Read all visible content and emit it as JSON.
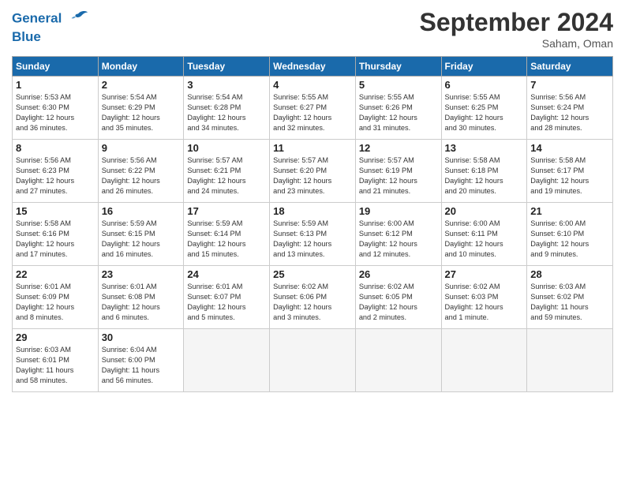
{
  "header": {
    "logo_line1": "General",
    "logo_line2": "Blue",
    "month_title": "September 2024",
    "location": "Saham, Oman"
  },
  "days_of_week": [
    "Sunday",
    "Monday",
    "Tuesday",
    "Wednesday",
    "Thursday",
    "Friday",
    "Saturday"
  ],
  "weeks": [
    [
      {
        "num": "1",
        "sunrise": "5:53 AM",
        "sunset": "6:30 PM",
        "daylight": "12 hours and 36 minutes."
      },
      {
        "num": "2",
        "sunrise": "5:54 AM",
        "sunset": "6:29 PM",
        "daylight": "12 hours and 35 minutes."
      },
      {
        "num": "3",
        "sunrise": "5:54 AM",
        "sunset": "6:28 PM",
        "daylight": "12 hours and 34 minutes."
      },
      {
        "num": "4",
        "sunrise": "5:55 AM",
        "sunset": "6:27 PM",
        "daylight": "12 hours and 32 minutes."
      },
      {
        "num": "5",
        "sunrise": "5:55 AM",
        "sunset": "6:26 PM",
        "daylight": "12 hours and 31 minutes."
      },
      {
        "num": "6",
        "sunrise": "5:55 AM",
        "sunset": "6:25 PM",
        "daylight": "12 hours and 30 minutes."
      },
      {
        "num": "7",
        "sunrise": "5:56 AM",
        "sunset": "6:24 PM",
        "daylight": "12 hours and 28 minutes."
      }
    ],
    [
      {
        "num": "8",
        "sunrise": "5:56 AM",
        "sunset": "6:23 PM",
        "daylight": "12 hours and 27 minutes."
      },
      {
        "num": "9",
        "sunrise": "5:56 AM",
        "sunset": "6:22 PM",
        "daylight": "12 hours and 26 minutes."
      },
      {
        "num": "10",
        "sunrise": "5:57 AM",
        "sunset": "6:21 PM",
        "daylight": "12 hours and 24 minutes."
      },
      {
        "num": "11",
        "sunrise": "5:57 AM",
        "sunset": "6:20 PM",
        "daylight": "12 hours and 23 minutes."
      },
      {
        "num": "12",
        "sunrise": "5:57 AM",
        "sunset": "6:19 PM",
        "daylight": "12 hours and 21 minutes."
      },
      {
        "num": "13",
        "sunrise": "5:58 AM",
        "sunset": "6:18 PM",
        "daylight": "12 hours and 20 minutes."
      },
      {
        "num": "14",
        "sunrise": "5:58 AM",
        "sunset": "6:17 PM",
        "daylight": "12 hours and 19 minutes."
      }
    ],
    [
      {
        "num": "15",
        "sunrise": "5:58 AM",
        "sunset": "6:16 PM",
        "daylight": "12 hours and 17 minutes."
      },
      {
        "num": "16",
        "sunrise": "5:59 AM",
        "sunset": "6:15 PM",
        "daylight": "12 hours and 16 minutes."
      },
      {
        "num": "17",
        "sunrise": "5:59 AM",
        "sunset": "6:14 PM",
        "daylight": "12 hours and 15 minutes."
      },
      {
        "num": "18",
        "sunrise": "5:59 AM",
        "sunset": "6:13 PM",
        "daylight": "12 hours and 13 minutes."
      },
      {
        "num": "19",
        "sunrise": "6:00 AM",
        "sunset": "6:12 PM",
        "daylight": "12 hours and 12 minutes."
      },
      {
        "num": "20",
        "sunrise": "6:00 AM",
        "sunset": "6:11 PM",
        "daylight": "12 hours and 10 minutes."
      },
      {
        "num": "21",
        "sunrise": "6:00 AM",
        "sunset": "6:10 PM",
        "daylight": "12 hours and 9 minutes."
      }
    ],
    [
      {
        "num": "22",
        "sunrise": "6:01 AM",
        "sunset": "6:09 PM",
        "daylight": "12 hours and 8 minutes."
      },
      {
        "num": "23",
        "sunrise": "6:01 AM",
        "sunset": "6:08 PM",
        "daylight": "12 hours and 6 minutes."
      },
      {
        "num": "24",
        "sunrise": "6:01 AM",
        "sunset": "6:07 PM",
        "daylight": "12 hours and 5 minutes."
      },
      {
        "num": "25",
        "sunrise": "6:02 AM",
        "sunset": "6:06 PM",
        "daylight": "12 hours and 3 minutes."
      },
      {
        "num": "26",
        "sunrise": "6:02 AM",
        "sunset": "6:05 PM",
        "daylight": "12 hours and 2 minutes."
      },
      {
        "num": "27",
        "sunrise": "6:02 AM",
        "sunset": "6:03 PM",
        "daylight": "12 hours and 1 minute."
      },
      {
        "num": "28",
        "sunrise": "6:03 AM",
        "sunset": "6:02 PM",
        "daylight": "11 hours and 59 minutes."
      }
    ],
    [
      {
        "num": "29",
        "sunrise": "6:03 AM",
        "sunset": "6:01 PM",
        "daylight": "11 hours and 58 minutes."
      },
      {
        "num": "30",
        "sunrise": "6:04 AM",
        "sunset": "6:00 PM",
        "daylight": "11 hours and 56 minutes."
      },
      null,
      null,
      null,
      null,
      null
    ]
  ]
}
